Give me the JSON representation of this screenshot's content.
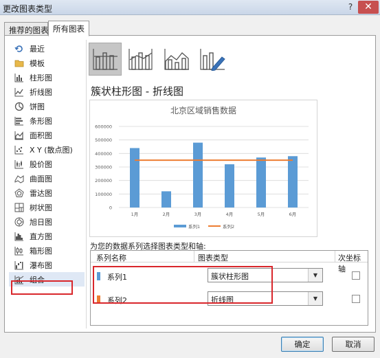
{
  "window": {
    "title": "更改图表类型",
    "help_glyph": "?",
    "close_glyph": "✕"
  },
  "tabs": [
    {
      "label": "推荐的图表"
    },
    {
      "label": "所有图表"
    }
  ],
  "sidebar": {
    "items": [
      {
        "label": "最近",
        "icon": "recent-icon"
      },
      {
        "label": "模板",
        "icon": "folder-icon"
      },
      {
        "label": "柱形图",
        "icon": "column-chart-icon"
      },
      {
        "label": "折线图",
        "icon": "line-chart-icon"
      },
      {
        "label": "饼图",
        "icon": "pie-chart-icon"
      },
      {
        "label": "条形图",
        "icon": "bar-chart-icon"
      },
      {
        "label": "面积图",
        "icon": "area-chart-icon"
      },
      {
        "label": "X Y (散点图)",
        "icon": "scatter-chart-icon"
      },
      {
        "label": "股价图",
        "icon": "stock-chart-icon"
      },
      {
        "label": "曲面图",
        "icon": "surface-chart-icon"
      },
      {
        "label": "雷达图",
        "icon": "radar-chart-icon"
      },
      {
        "label": "树状图",
        "icon": "treemap-icon"
      },
      {
        "label": "旭日图",
        "icon": "sunburst-icon"
      },
      {
        "label": "直方图",
        "icon": "histogram-icon"
      },
      {
        "label": "箱形图",
        "icon": "box-whisker-icon"
      },
      {
        "label": "瀑布图",
        "icon": "waterfall-icon"
      },
      {
        "label": "组合",
        "icon": "combo-chart-icon"
      }
    ],
    "selected_index": 16
  },
  "subtype_title": "簇状柱形图 - 折线图",
  "assign_label": "为您的数据系列选择图表类型和轴:",
  "series_table": {
    "headers": {
      "name": "系列名称",
      "type": "图表类型",
      "secondary": "次坐标轴"
    },
    "rows": [
      {
        "name": "系列1",
        "color": "#5b9bd5",
        "type": "簇状柱形图",
        "secondary": false
      },
      {
        "name": "系列2",
        "color": "#ed7d31",
        "type": "折线图",
        "secondary": false
      }
    ]
  },
  "buttons": {
    "ok": "确定",
    "cancel": "取消"
  },
  "chart_data": {
    "type": "bar",
    "title": "北京区域销售数据",
    "categories": [
      "1月",
      "2月",
      "3月",
      "4月",
      "5月",
      "6月"
    ],
    "ylim": [
      0,
      600000
    ],
    "yticks": [
      "0",
      "100000",
      "200000",
      "300000",
      "400000",
      "500000",
      "600000"
    ],
    "grid": true,
    "legend_position": "bottom",
    "series": [
      {
        "name": "系列1",
        "kind": "bar",
        "color": "#5b9bd5",
        "values": [
          440000,
          120000,
          480000,
          320000,
          370000,
          380000
        ]
      },
      {
        "name": "系列2",
        "kind": "line",
        "color": "#ed7d31",
        "values": [
          350000,
          350000,
          350000,
          350000,
          350000,
          350000
        ]
      }
    ]
  }
}
